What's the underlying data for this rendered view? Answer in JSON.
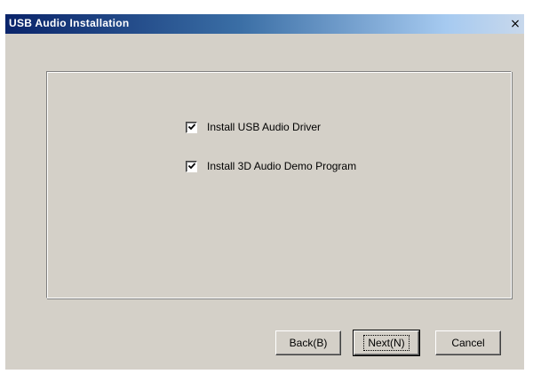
{
  "window": {
    "title": "USB Audio Installation",
    "close_glyph": "×",
    "close_icon": "close-icon"
  },
  "options": [
    {
      "label": "Install USB Audio Driver",
      "checked": true
    },
    {
      "label": "Install 3D Audio Demo Program",
      "checked": true
    }
  ],
  "buttons": {
    "back_label": "Back(B)",
    "next_label": "Next(N)",
    "cancel_label": "Cancel"
  },
  "colors": {
    "face": "#d4d0c8",
    "titlebar_start": "#0a246a",
    "titlebar_end": "#a6caf0",
    "title_text": "#ffffff"
  }
}
